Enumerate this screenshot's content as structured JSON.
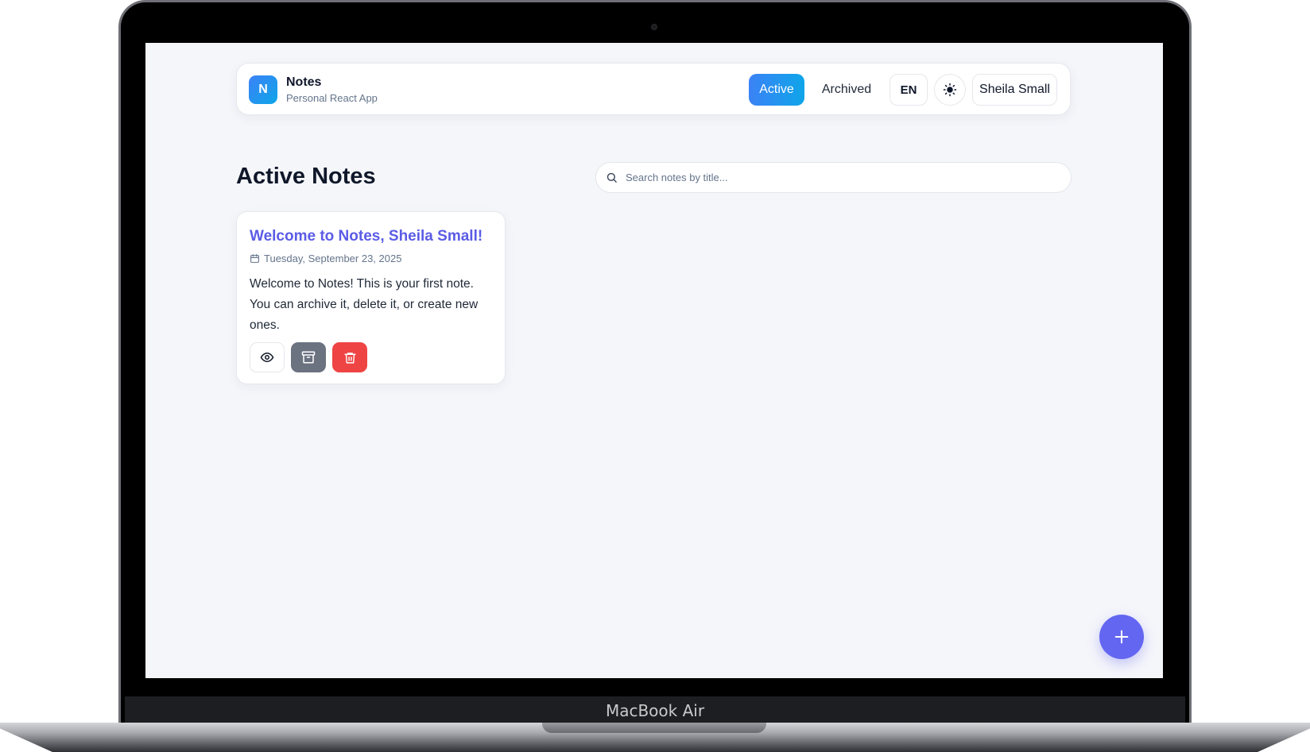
{
  "app": {
    "logo_letter": "N",
    "title": "Notes",
    "subtitle": "Personal React App"
  },
  "nav": {
    "active_label": "Active",
    "archived_label": "Archived",
    "language": "EN",
    "theme_icon": "sun-icon",
    "user_name": "Sheila Small"
  },
  "page": {
    "heading": "Active Notes"
  },
  "search": {
    "placeholder": "Search notes by title...",
    "value": ""
  },
  "notes": [
    {
      "title": "Welcome to Notes, Sheila Small!",
      "date": "Tuesday, September 23, 2025",
      "body": "Welcome to Notes! This is your first note. You can archive it, delete it, or create new ones.",
      "actions": [
        "eye-icon",
        "archive-icon",
        "trash-icon"
      ]
    }
  ],
  "fab": {
    "icon": "plus-icon"
  },
  "device": {
    "label": "MacBook Air"
  },
  "colors": {
    "accent": "#3b82f6",
    "accent_2": "#0ea5e9",
    "note_title": "#5b5ce6",
    "archive": "#6b7280",
    "delete": "#ef4444",
    "fab": "#6366f1",
    "background": "#f5f6fa"
  }
}
